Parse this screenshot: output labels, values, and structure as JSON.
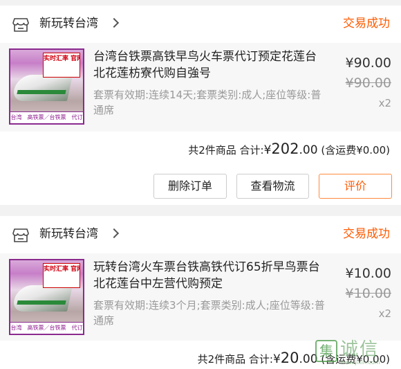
{
  "orders": [
    {
      "store_name": "新玩转台湾",
      "status": "交易成功",
      "item": {
        "thumb_badge": "实时汇率 官网预订",
        "thumb_strip": "台湾　高铁票／台铁票　代订",
        "title": "台湾台铁票高铁早鸟火车票代订预定花莲台北花莲枋寮代购自強号",
        "spec": "套票有效期:连续14天;套票类别:成人;座位等级:普通席",
        "price": "¥90.00",
        "original_price": "¥90.00",
        "quantity": "x2"
      },
      "summary": {
        "count_text": "共2件商品",
        "total_label": "合计:",
        "currency": "¥",
        "total_int": "202",
        "total_dec": ".00",
        "shipping_text": "(含运费¥0.00)"
      },
      "buttons": {
        "delete": "删除订单",
        "logistics": "查看物流",
        "review": "评价"
      }
    },
    {
      "store_name": "新玩转台湾",
      "status": "交易成功",
      "item": {
        "thumb_badge": "实时汇率 官网预订",
        "thumb_strip": "台湾　高铁票／台铁票　代订",
        "title": "玩转台湾火车票台铁高铁代订65折早鸟票台北花莲台中左营代购预定",
        "spec": "套票有效期:连续3个月;套票类别:成人;座位等级:普通席",
        "price": "¥10.00",
        "original_price": "¥10.00",
        "quantity": "x2"
      },
      "summary": {
        "count_text": "共2件商品",
        "total_label": "合计:",
        "currency": "¥",
        "total_int": "20",
        "total_dec": ".00",
        "shipping_text": "(含运费¥0.00)"
      }
    }
  ],
  "watermark": {
    "logo": "集",
    "text": "诚信",
    "url": "www.jixin.com"
  },
  "colors": {
    "accent": "#ff5a00",
    "muted": "#999999",
    "card_bg": "#f7f7f7",
    "page_bg": "#f2f2f2"
  },
  "icons": {
    "store": "store-icon",
    "chevron": "chevron-right-icon"
  }
}
